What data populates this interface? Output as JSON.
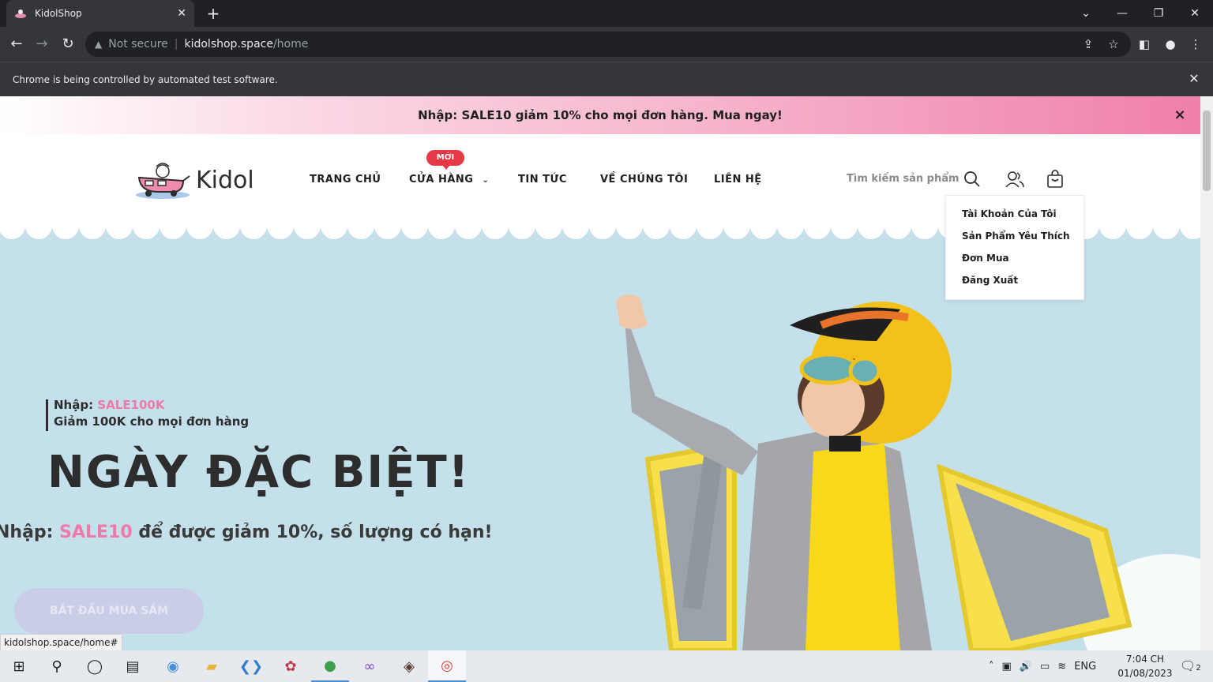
{
  "browser": {
    "tab_title": "KidolShop",
    "tab_close": "✕",
    "new_tab": "+",
    "security_label": "Not secure",
    "url_host": "kidolshop.space",
    "url_path": "/home",
    "infobar_text": "Chrome is being controlled by automated test software.",
    "status_url": "kidolshop.space/home#"
  },
  "promo": {
    "text": "Nhập: SALE10 giảm 10% cho mọi đơn hàng. Mua ngay!",
    "close": "×"
  },
  "header": {
    "logo_text": "Kidol",
    "nav": [
      "TRANG CHỦ",
      "CỬA HÀNG",
      "TIN TỨC",
      "VỀ CHÚNG TÔI",
      "LIÊN HỆ"
    ],
    "new_badge": "MỚI",
    "search_placeholder": "Tìm kiếm sản phẩm"
  },
  "account_menu": {
    "items": [
      "Tài Khoản Của Tôi",
      "Sản Phẩm Yêu Thích",
      "Đơn Mua",
      "Đăng Xuất"
    ]
  },
  "hero": {
    "coupon_prefix": "Nhập: ",
    "coupon_code": "SALE100K",
    "coupon_desc": "Giảm 100K cho mọi đơn hàng",
    "title": "NGÀY ĐẶC BIỆT!",
    "sub_prefix": "Nhập: ",
    "sub_code": "SALE10",
    "sub_suffix": " để được giảm 10%, số lượng có hạn!",
    "cta": "BẮT ĐẦU MUA SẮM"
  },
  "taskbar": {
    "tray_lang": "ENG",
    "time": "7:04 CH",
    "date": "01/08/2023",
    "notifications": "2"
  },
  "colors": {
    "accent_pink": "#ef7aa9",
    "hero_bg": "#c4e0ea",
    "badge_red": "#e63946"
  }
}
